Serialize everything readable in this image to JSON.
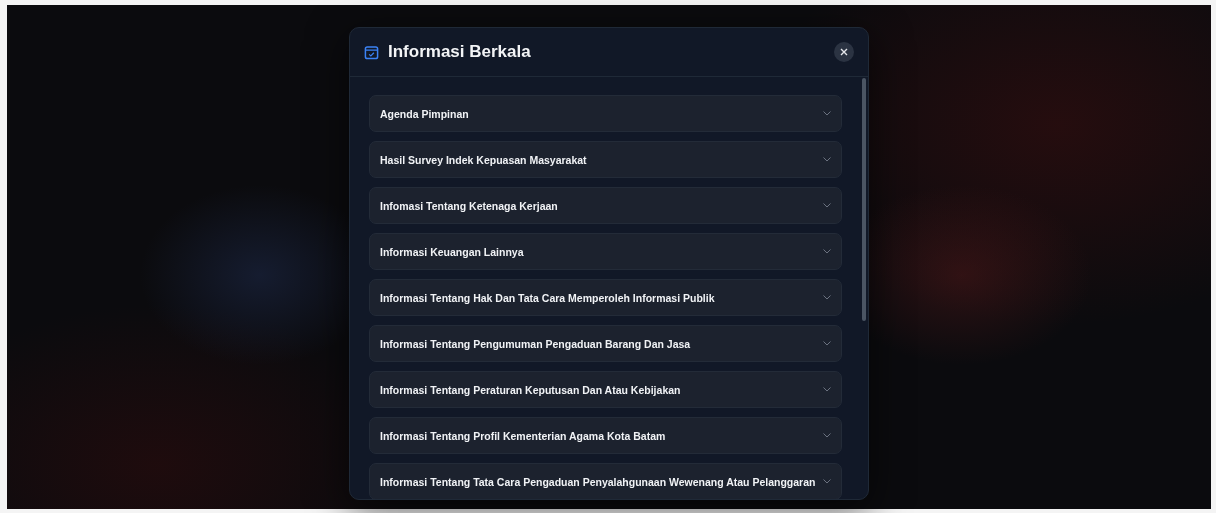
{
  "dialog": {
    "title": "Informasi Berkala",
    "items": [
      {
        "label": "Agenda Pimpinan",
        "expanded": false
      },
      {
        "label": "Hasil Survey Indek Kepuasan Masyarakat",
        "expanded": false
      },
      {
        "label": "Infomasi Tentang Ketenaga Kerjaan",
        "expanded": false
      },
      {
        "label": "Informasi Keuangan Lainnya",
        "expanded": false
      },
      {
        "label": "Informasi Tentang Hak Dan Tata Cara Memperoleh Informasi Publik",
        "expanded": false
      },
      {
        "label": "Informasi Tentang Pengumuman Pengaduan Barang Dan Jasa",
        "expanded": false
      },
      {
        "label": "Informasi Tentang Peraturan Keputusan Dan Atau Kebijakan",
        "expanded": false
      },
      {
        "label": "Informasi Tentang Profil Kementerian Agama Kota Batam",
        "expanded": false
      },
      {
        "label": "Informasi Tentang Tata Cara Pengaduan Penyalahgunaan Wewenang Atau Pelanggaran",
        "expanded": false
      }
    ]
  }
}
